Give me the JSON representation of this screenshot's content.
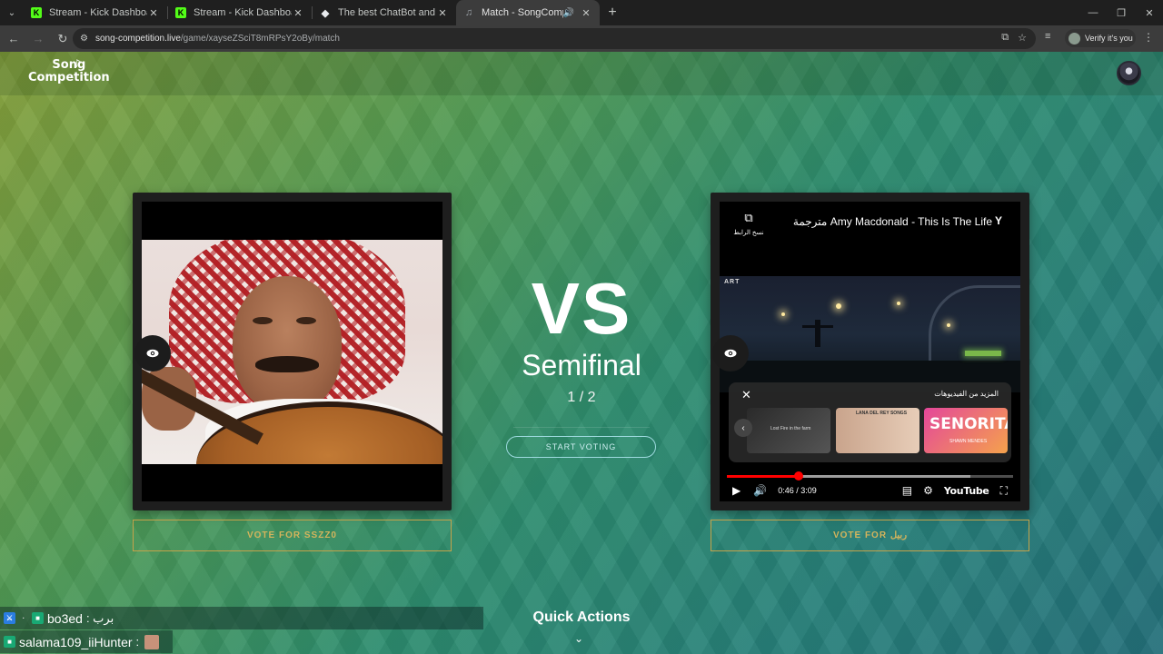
{
  "browser": {
    "tabs": [
      {
        "label": "Stream - Kick Dashboard",
        "icon": "kick-icon"
      },
      {
        "label": "Stream - Kick Dashboard",
        "icon": "kick-icon"
      },
      {
        "label": "The best ChatBot and Widgets",
        "icon": "chatbot-icon"
      },
      {
        "label": "Match - SongCompetition",
        "icon": "songcompetition-icon",
        "active": true
      }
    ],
    "url_host": "song-competition.live",
    "url_path": "/game/xayseZSciT8mRPsY2oBy/match",
    "verify_label": "Verify it's you"
  },
  "site": {
    "logo_line1": "Song",
    "logo_line2": "Competition"
  },
  "match": {
    "vs": "VS",
    "stage": "Semifinal",
    "round": "1 / 2",
    "start_voting": "START VOTING",
    "vote_left": "VOTE FOR SSZZ0",
    "vote_right": "VOTE FOR ربيل"
  },
  "youtube": {
    "title": "مترجمة Amy Macdonald - This Is The Life",
    "copy_link": "نسخ الرابط",
    "more_videos": "المزيد من الفيديوهات",
    "video_watermark": "ART",
    "thumb1_text": "Lost Fire in the farm",
    "thumb2_text": "LANA DEL REY SONGS",
    "thumb3_title": "SENORITA",
    "thumb3_sub": "SHAWN MENDES",
    "time": "0:46 / 3:09",
    "played_fraction": 0.25,
    "loaded_fraction": 0.85,
    "logo": "YouTube"
  },
  "quick_actions": "Quick Actions",
  "chat": [
    {
      "user": "bo3ed",
      "message": ": برب"
    },
    {
      "user": "salama109_iiHunter",
      "message": ":"
    }
  ]
}
